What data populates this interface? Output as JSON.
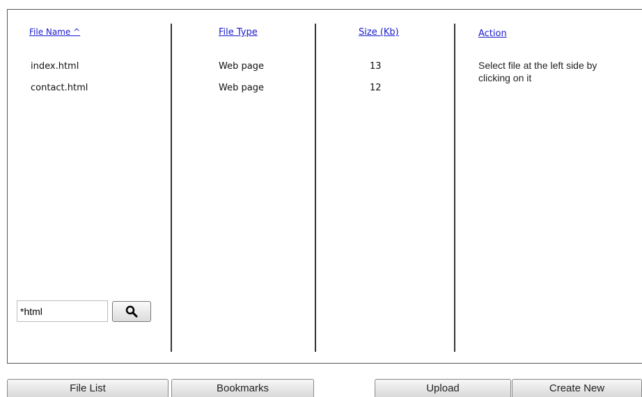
{
  "table": {
    "headers": {
      "file_name": "File Name ^",
      "file_type": "File Type",
      "size": "Size (Kb)",
      "action": "Action"
    },
    "rows": [
      {
        "name": "index.html",
        "type": "Web page",
        "size": "13"
      },
      {
        "name": "contact.html",
        "type": "Web page",
        "size": "12"
      }
    ],
    "action_text": "Select file at the left side by clicking on it"
  },
  "search": {
    "value": "*html",
    "icon": "search-icon"
  },
  "bottom_tabs": {
    "file_list": "File List",
    "bookmarks": "Bookmarks",
    "upload": "Upload",
    "create_new": "Create New"
  },
  "colors": {
    "link": "#1a1ad0",
    "border": "#555555"
  }
}
